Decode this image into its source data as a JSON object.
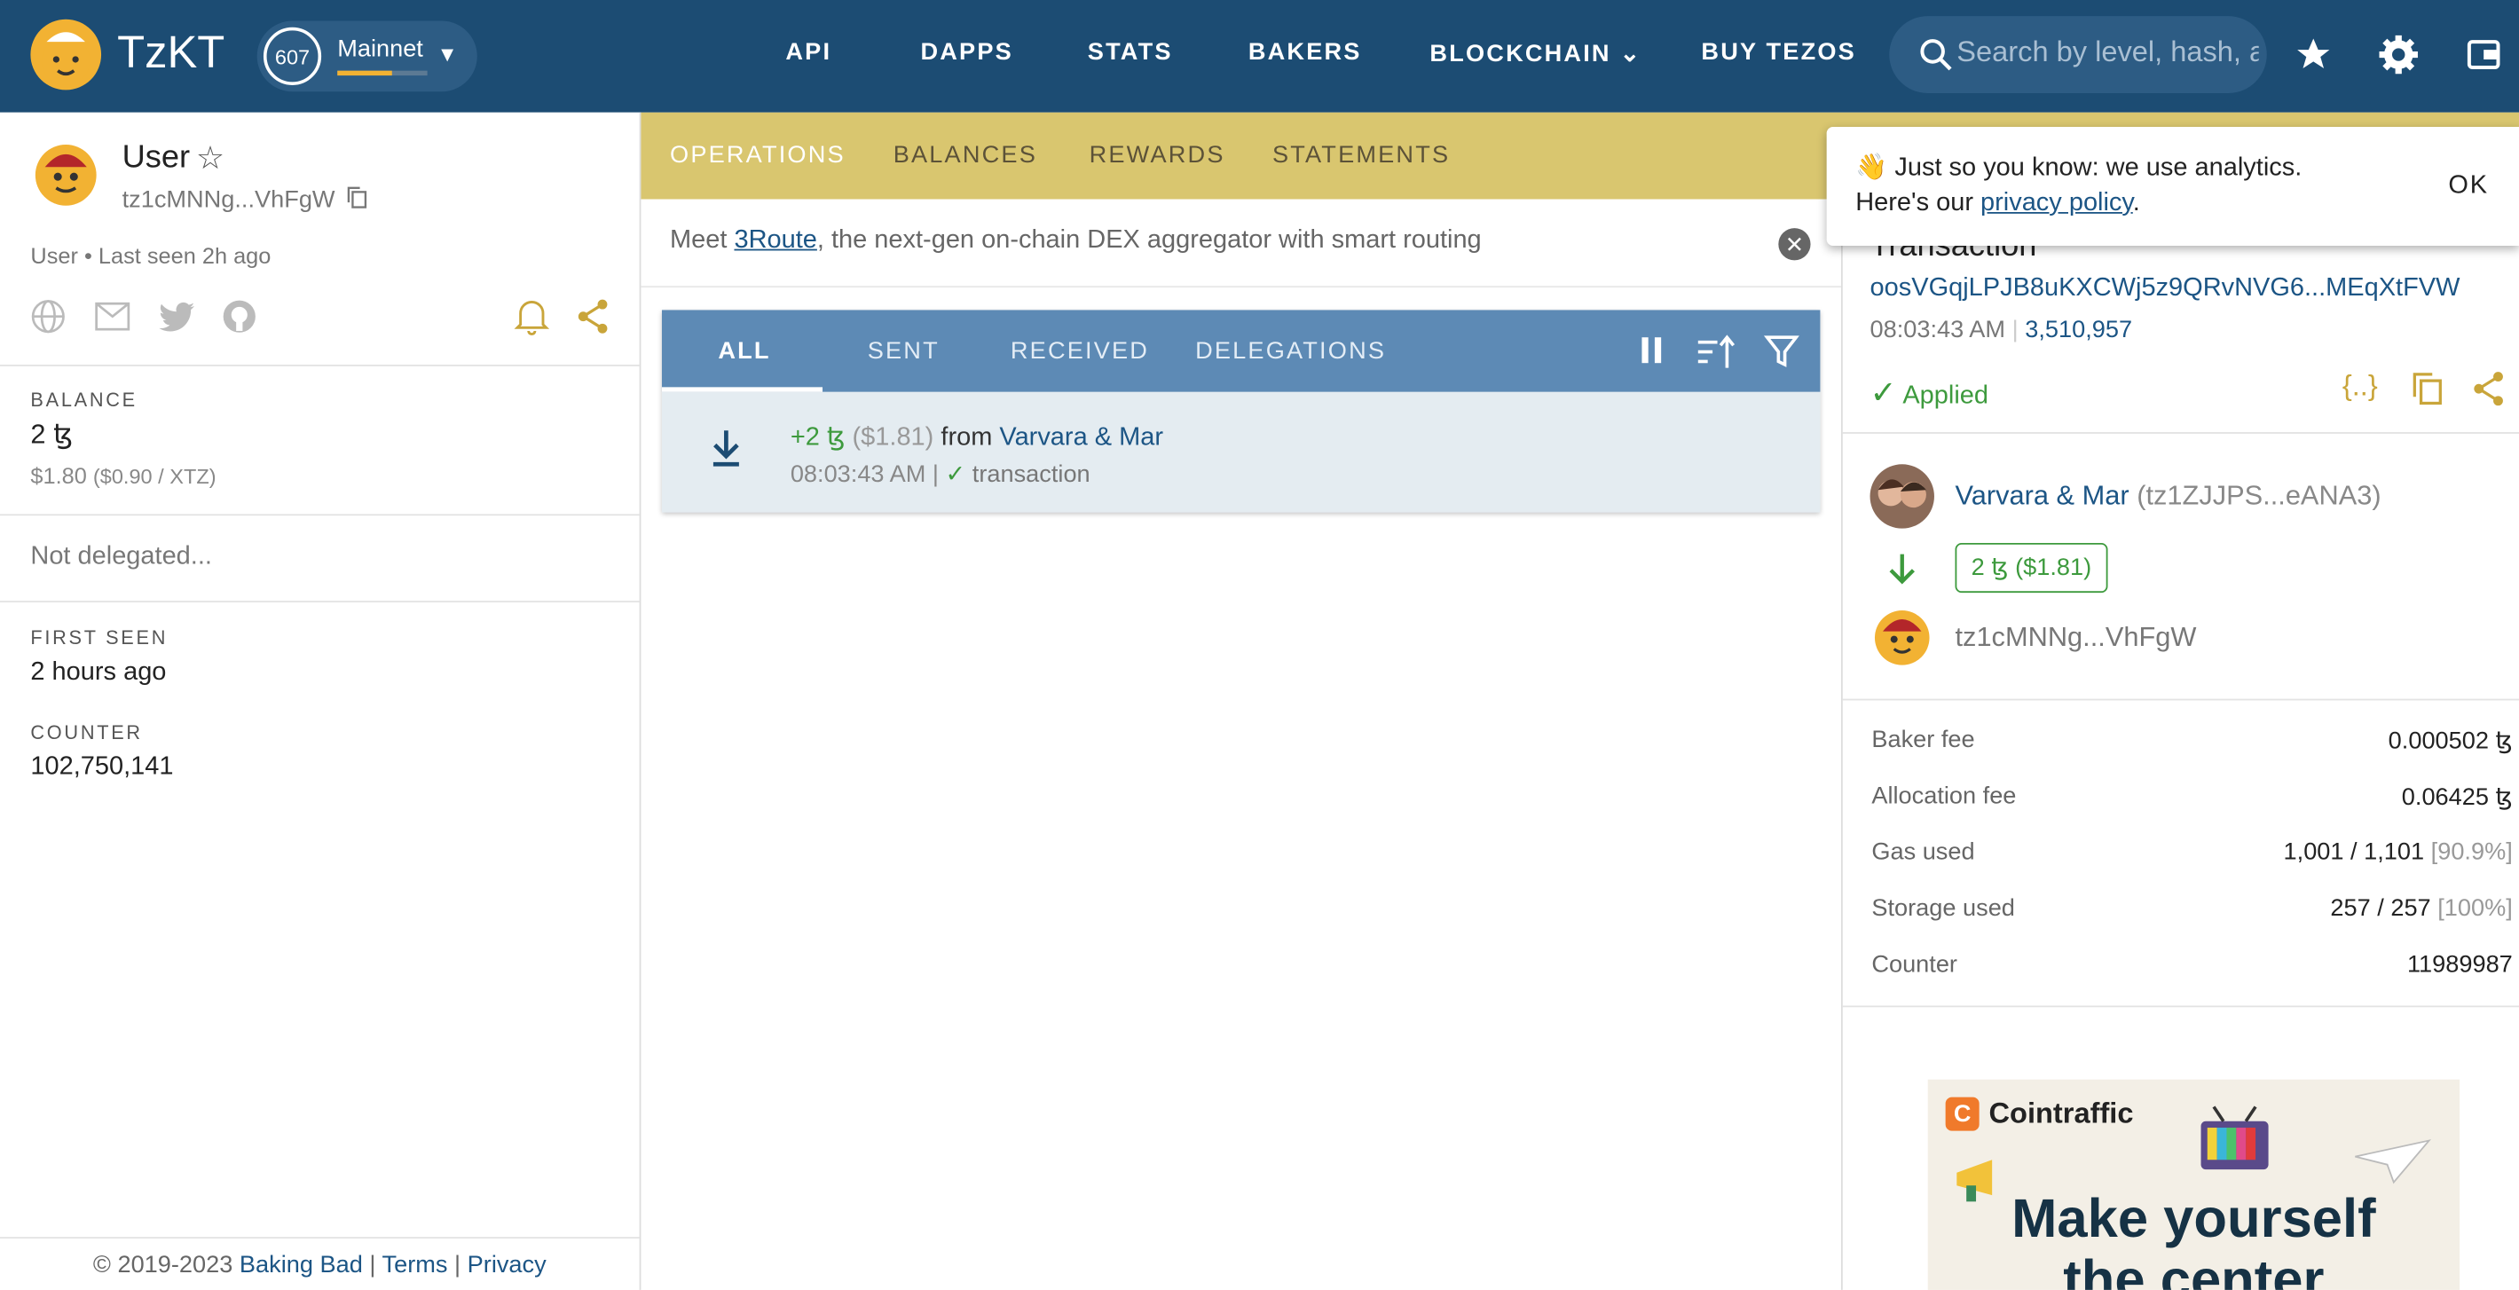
{
  "header": {
    "brand": "TzKT",
    "network": {
      "cycle": "607",
      "name": "Mainnet",
      "cycle_progress": 0.6
    },
    "nav": [
      "API",
      "DAPPS",
      "STATS",
      "BAKERS",
      "BLOCKCHAIN",
      "BUY TEZOS"
    ],
    "search_placeholder": "Search by level, hash, al"
  },
  "account": {
    "name": "User",
    "address": "tz1cMNNg...VhFgW",
    "meta": "User • Last seen 2h ago",
    "balance_label": "BALANCE",
    "balance": "2 ꜩ",
    "balance_usd": "$1.80",
    "rate": "($0.90 / XTZ)",
    "delegation": "Not delegated...",
    "first_seen_label": "FIRST SEEN",
    "first_seen": "2 hours ago",
    "counter_label": "COUNTER",
    "counter": "102,750,141"
  },
  "footer": {
    "copyright": "© 2019-2023",
    "company": "Baking Bad",
    "sep": "|",
    "terms": "Terms",
    "privacy": "Privacy"
  },
  "tabs": [
    "OPERATIONS",
    "BALANCES",
    "REWARDS",
    "STATEMENTS"
  ],
  "banner": {
    "prefix": "Meet ",
    "link": "3Route",
    "suffix": ", the next-gen on-chain DEX aggregator with smart routing"
  },
  "subtabs": [
    "ALL",
    "SENT",
    "RECEIVED",
    "DELEGATIONS"
  ],
  "operation": {
    "amount": "+2 ꜩ",
    "usd": "($1.81)",
    "from_word": "from",
    "from": "Varvara & Mar",
    "time": "08:03:43 AM |",
    "kind": "transaction"
  },
  "cookie": {
    "emoji": "👋",
    "line1": "Just so you know: we use analytics.",
    "line2_prefix": "Here's our ",
    "link": "privacy policy",
    "line2_suffix": ".",
    "ok": "OK"
  },
  "tx": {
    "title": "Transaction",
    "hash": "oosVGqjLPJB8uKXCWj5z9QRvNVG6...MEqXtFVW",
    "time": "08:03:43 AM",
    "level": "3,510,957",
    "status": "Applied",
    "sender_name": "Varvara & Mar",
    "sender_addr": "(tz1ZJJPS...eANA3)",
    "amount": "2 ꜩ ($1.81)",
    "receiver": "tz1cMNNg...VhFgW",
    "fees": [
      {
        "label": "Baker fee",
        "value": "0.000502 ꜩ"
      },
      {
        "label": "Allocation fee",
        "value": "0.06425 ꜩ"
      },
      {
        "label": "Gas used",
        "value": "1,001 / 1,101",
        "extra": "[90.9%]"
      },
      {
        "label": "Storage used",
        "value": "257 / 257",
        "extra": "[100%]"
      },
      {
        "label": "Counter",
        "value": "11989987"
      }
    ]
  },
  "ad": {
    "brand": "Cointraffic",
    "line1": "Make yourself",
    "line2": "the center"
  },
  "colors": {
    "header": "#1c4c73",
    "tabs": "#d9c66f",
    "subtabs": "#5d8ab5",
    "accent": "#f2b233",
    "success": "#3d9a3d",
    "link": "#1c5585"
  }
}
